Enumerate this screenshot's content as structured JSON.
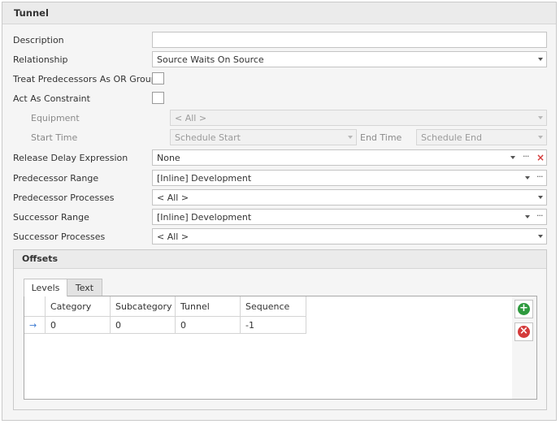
{
  "panel": {
    "title": "Tunnel"
  },
  "form": {
    "description": {
      "label": "Description",
      "value": ""
    },
    "relationship": {
      "label": "Relationship",
      "value": "Source Waits On Source"
    },
    "treat_predecessors": {
      "label": "Treat Predecessors As OR Group",
      "checked": false
    },
    "act_as_constraint": {
      "label": "Act As Constraint",
      "checked": false
    },
    "equipment": {
      "label": "Equipment",
      "value": "< All >"
    },
    "start_time": {
      "label": "Start Time",
      "value": "Schedule Start"
    },
    "end_time": {
      "label": "End Time",
      "value": "Schedule End"
    },
    "release_delay": {
      "label": "Release Delay Expression",
      "value": "None"
    },
    "predecessor_range": {
      "label": "Predecessor Range",
      "value": "[Inline] Development"
    },
    "predecessor_processes": {
      "label": "Predecessor Processes",
      "value": "< All >"
    },
    "successor_range": {
      "label": "Successor Range",
      "value": "[Inline] Development"
    },
    "successor_processes": {
      "label": "Successor Processes",
      "value": "< All >"
    }
  },
  "offsets": {
    "title": "Offsets",
    "tabs": [
      {
        "label": "Levels",
        "active": true
      },
      {
        "label": "Text",
        "active": false
      }
    ],
    "columns": [
      "Category",
      "Subcategory",
      "Tunnel",
      "Sequence"
    ],
    "rows": [
      {
        "indicator": "→",
        "cells": [
          "0",
          "0",
          "0",
          "-1"
        ]
      }
    ],
    "buttons": {
      "add_icon": "add-circle-icon",
      "remove_icon": "remove-circle-icon"
    }
  },
  "colors": {
    "add": "#2e9a3e",
    "remove": "#d43b3b",
    "accent": "#3d7bd1"
  }
}
